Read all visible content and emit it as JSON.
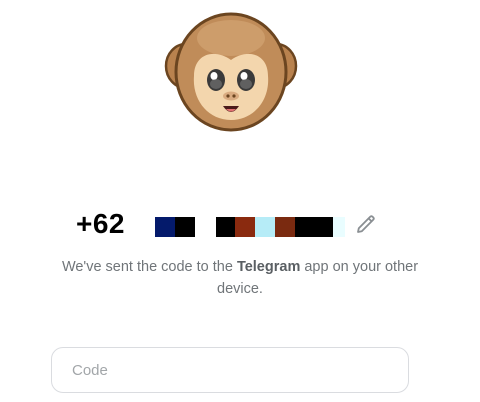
{
  "phone": {
    "prefix": "+62",
    "masked_blocks": [
      [
        "#041a6b",
        "#000000"
      ],
      [
        "#000000",
        "#8a2a0f",
        "#b6ecf7",
        "#7a2a10",
        "#000000",
        "#000000",
        "#e9fdff"
      ]
    ]
  },
  "message": {
    "before": "We've sent the code to the ",
    "app_name": "Telegram",
    "after": " app on your other device."
  },
  "code_input": {
    "placeholder": "Code",
    "value": ""
  },
  "icons": {
    "avatar": "monkey-covering-eyes-icon",
    "edit": "pencil-icon"
  },
  "colors": {
    "text_secondary": "#707579",
    "input_border": "#dadce0",
    "monkey_fur": "#b97f4a",
    "monkey_face": "#f3d6ad"
  }
}
